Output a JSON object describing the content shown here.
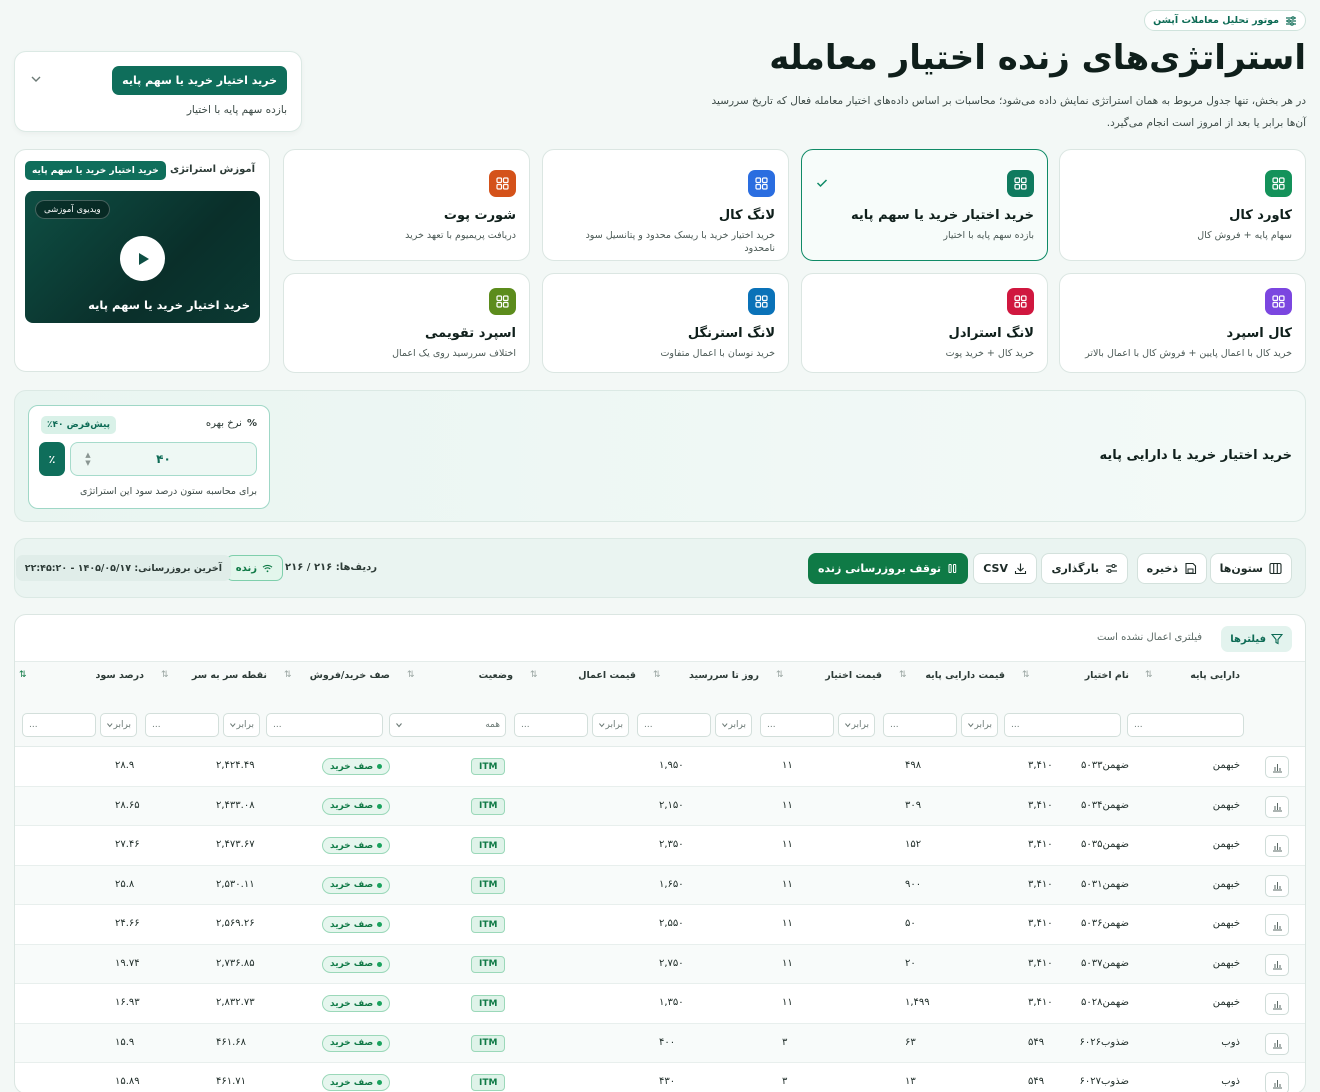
{
  "header": {
    "badge": "موتور تحلیل معاملات آپشن",
    "title": "استراتژی‌های زنده اختیار معامله",
    "desc": "در هر بخش، تنها جدول مربوط به همان استراتژی نمایش داده می‌شود؛ محاسبات بر اساس داده‌های اختیار معامله فعال که تاریخ سررسید آن‌ها برابر یا بعد از امروز است انجام می‌گیرد."
  },
  "selector": {
    "value": "خرید اختیار خرید یا سهم پایه",
    "subtitle": "بازده سهم پایه با اختیار"
  },
  "cards": [
    {
      "title": "کاورد کال",
      "sub": "سهام پایه + فروش کال",
      "color": "#14925a",
      "active": false
    },
    {
      "title": "خرید اختیار خرید یا سهم پایه",
      "sub": "بازده سهم پایه با اختیار",
      "color": "#0f7a5e",
      "active": true
    },
    {
      "title": "لانگ کال",
      "sub": "خرید اختیار خرید با ریسک محدود و پتانسیل سود نامحدود",
      "color": "#2a6de0",
      "active": false
    },
    {
      "title": "شورت پوت",
      "sub": "دریافت پریمیوم با تعهد خرید",
      "color": "#d4521a",
      "active": false
    },
    {
      "title": "کال اسپرد",
      "sub": "خرید کال با اعمال پایین + فروش کال با اعمال بالاتر",
      "color": "#7b46e0",
      "active": false
    },
    {
      "title": "لانگ استرادل",
      "sub": "خرید کال + خرید پوت",
      "color": "#d0173f",
      "active": false
    },
    {
      "title": "لانگ استرنگل",
      "sub": "خرید نوسان با اعمال متفاوت",
      "color": "#0a72b8",
      "active": false
    },
    {
      "title": "اسپرد تقویمی",
      "sub": "اختلاف سررسید روی یک اعمال",
      "color": "#5c8c1c",
      "active": false
    }
  ],
  "education": {
    "label": "آموزش استراتژی",
    "pill": "خرید اختیار خرید یا سهم پایه",
    "video_badge": "ویدیوی آموزشی",
    "video_title": "خرید اختیار خرید یا سهم پایه"
  },
  "panel": {
    "title": "خرید اختیار خرید یا دارایی پایه",
    "rate_label": "نرخ بهره",
    "rate_default": "پیش‌فرض ۴۰٪",
    "rate_value": "۴۰",
    "rate_unit": "٪",
    "rate_help": "برای محاسبه ستون درصد سود این استراتژی"
  },
  "toolbar": {
    "columns": "ستون‌ها",
    "save": "ذخیره",
    "load": "بارگذاری",
    "csv": "CSV",
    "stop": "توقف بروزرسانی زنده",
    "rows": "ردیف‌ها: ۲۱۶ / ۲۱۶",
    "live": "زنده",
    "updated": "آخرین بروزرسانی: ۱۴۰۵/۰۵/۱۷ - ۲۲:۴۵:۲۰"
  },
  "filters": {
    "button": "فیلترها",
    "note": "فیلتری اعمال نشده است",
    "text_placeholder": "...",
    "op_value": "برابر",
    "status_value": "همه"
  },
  "columns": [
    "دارایی پایه",
    "نام اختیار",
    "قیمت دارایی پایه",
    "قیمت اختیار",
    "روز تا سررسید",
    "قیمت اعمال",
    "وضعیت",
    "صف خرید/فروش",
    "نقطه سر به سر",
    "درصد سود"
  ],
  "rows": [
    {
      "asset": "خبهمن",
      "option": "ضهمن۵۰۳۳",
      "under": "۳,۴۱۰",
      "price": "۴۹۸",
      "days": "۱۱",
      "strike": "۱,۹۵۰",
      "status": "ITM",
      "queue": "صف خرید",
      "be": "۲,۴۲۴.۴۹",
      "pct": "۲۸.۹"
    },
    {
      "asset": "خبهمن",
      "option": "ضهمن۵۰۳۴",
      "under": "۳,۴۱۰",
      "price": "۳۰۹",
      "days": "۱۱",
      "strike": "۲,۱۵۰",
      "status": "ITM",
      "queue": "صف خرید",
      "be": "۲,۴۳۳.۰۸",
      "pct": "۲۸.۶۵"
    },
    {
      "asset": "خبهمن",
      "option": "ضهمن۵۰۳۵",
      "under": "۳,۴۱۰",
      "price": "۱۵۲",
      "days": "۱۱",
      "strike": "۲,۳۵۰",
      "status": "ITM",
      "queue": "صف خرید",
      "be": "۲,۴۷۳.۶۷",
      "pct": "۲۷.۴۶"
    },
    {
      "asset": "خبهمن",
      "option": "ضهمن۵۰۳۱",
      "under": "۳,۴۱۰",
      "price": "۹۰۰",
      "days": "۱۱",
      "strike": "۱,۶۵۰",
      "status": "ITM",
      "queue": "صف خرید",
      "be": "۲,۵۳۰.۱۱",
      "pct": "۲۵.۸"
    },
    {
      "asset": "خبهمن",
      "option": "ضهمن۵۰۳۶",
      "under": "۳,۴۱۰",
      "price": "۵۰",
      "days": "۱۱",
      "strike": "۲,۵۵۰",
      "status": "ITM",
      "queue": "صف خرید",
      "be": "۲,۵۶۹.۲۶",
      "pct": "۲۴.۶۶"
    },
    {
      "asset": "خبهمن",
      "option": "ضهمن۵۰۳۷",
      "under": "۳,۴۱۰",
      "price": "۲۰",
      "days": "۱۱",
      "strike": "۲,۷۵۰",
      "status": "ITM",
      "queue": "صف خرید",
      "be": "۲,۷۳۶.۸۵",
      "pct": "۱۹.۷۴"
    },
    {
      "asset": "خبهمن",
      "option": "ضهمن۵۰۲۸",
      "under": "۳,۴۱۰",
      "price": "۱,۴۹۹",
      "days": "۱۱",
      "strike": "۱,۳۵۰",
      "status": "ITM",
      "queue": "صف خرید",
      "be": "۲,۸۳۲.۷۳",
      "pct": "۱۶.۹۳"
    },
    {
      "asset": "ذوب",
      "option": "ضذوب۶۰۲۶",
      "under": "۵۴۹",
      "price": "۶۳",
      "days": "۳",
      "strike": "۴۰۰",
      "status": "ITM",
      "queue": "صف خرید",
      "be": "۴۶۱.۶۸",
      "pct": "۱۵.۹"
    },
    {
      "asset": "ذوب",
      "option": "ضذوب۶۰۲۷",
      "under": "۵۴۹",
      "price": "۱۳",
      "days": "۳",
      "strike": "۴۳۰",
      "status": "ITM",
      "queue": "صف خرید",
      "be": "۴۶۱.۷۱",
      "pct": "۱۵.۸۹"
    }
  ]
}
